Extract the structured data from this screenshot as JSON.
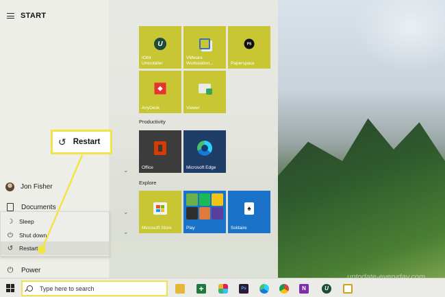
{
  "start": {
    "title": "START"
  },
  "rail": {
    "user": "Jon Fisher",
    "documents": "Documents",
    "power": "Power"
  },
  "power_menu": [
    {
      "label": "Sleep",
      "icon": "moon-icon"
    },
    {
      "label": "Shut down",
      "icon": "power-icon"
    },
    {
      "label": "Restart",
      "icon": "restart-icon"
    }
  ],
  "groups": {
    "productivity": "Productivity",
    "explore": "Explore"
  },
  "tiles": {
    "iobit": "IObit\nUninstaller",
    "vmware": "VMware\nWorkstation...",
    "paperspace": "Paperspace",
    "paperspace_badge": "PS",
    "anydesk": "AnyDesk",
    "viewer": "Viewer",
    "office": "Office",
    "edge": "Microsoft Edge",
    "store": "Microsoft Store",
    "play": "Play",
    "solitaire": "Solitaire"
  },
  "callout": {
    "label": "Restart"
  },
  "taskbar": {
    "search_placeholder": "Type here to search",
    "ps_badge": "Ps",
    "onenote_badge": "N"
  },
  "watermark": "uptodate-everyday.com",
  "colors": {
    "tile_yellow": "#c8c632",
    "tile_dark": "#3c3c3c",
    "tile_navy": "#1f3d67",
    "tile_blue": "#1a73c8",
    "highlight": "#f1e545"
  }
}
